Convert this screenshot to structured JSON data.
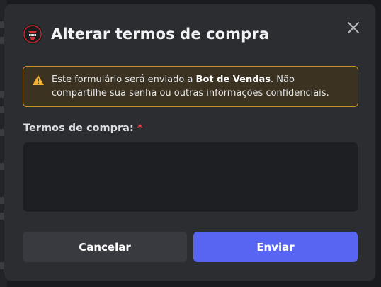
{
  "modal": {
    "title": "Alterar termos de compra",
    "bot_avatar_icon": "bot-avatar-icon",
    "close_icon": "close-icon"
  },
  "warning": {
    "icon": "warning-icon",
    "text_prefix": "Este formulário será enviado a ",
    "bot_name": "Bot de Vendas",
    "text_suffix": ". Não compartilhe sua senha ou outras informações confidenciais.",
    "border_color": "#c9952a"
  },
  "field": {
    "label": "Termos de compra:",
    "required_mark": "*",
    "value": ""
  },
  "buttons": {
    "cancel_label": "Cancelar",
    "submit_label": "Enviar",
    "submit_color": "#5865f2"
  }
}
